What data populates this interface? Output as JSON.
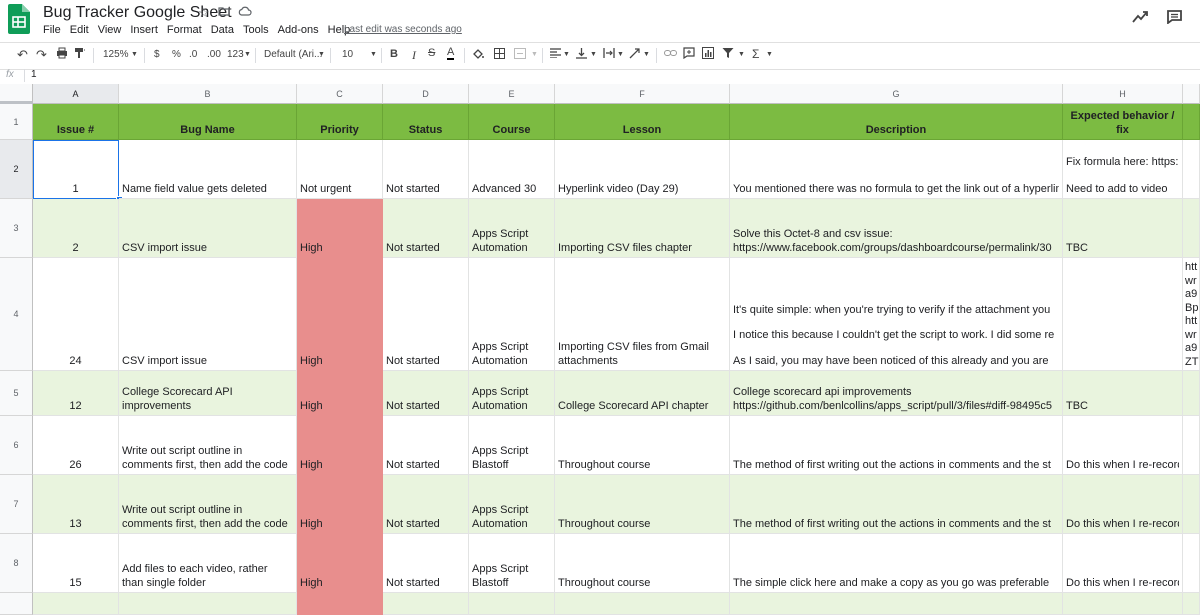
{
  "app": {
    "title": "Bug Tracker Google Sheet",
    "last_edit": "Last edit was seconds ago",
    "menus": [
      "File",
      "Edit",
      "View",
      "Insert",
      "Format",
      "Data",
      "Tools",
      "Add-ons",
      "Help"
    ],
    "brand_color": "#0f9d58"
  },
  "toolbar": {
    "zoom": "125%",
    "currency": "$",
    "percent": "%",
    "dec_decrease": ".0",
    "dec_increase": ".00",
    "more_formats": "123",
    "font": "Default (Ari...",
    "font_size": "10",
    "bold": "B",
    "italic": "I",
    "text_color": "A",
    "functions": "Σ"
  },
  "formula_bar": {
    "fx": "fx",
    "value": "1"
  },
  "columns": [
    "A",
    "B",
    "C",
    "D",
    "E",
    "F",
    "G",
    "H"
  ],
  "rows": [
    "1",
    "2",
    "3",
    "4",
    "5",
    "6",
    "7",
    "8"
  ],
  "header": {
    "issue": "Issue #",
    "bug_name": "Bug Name",
    "priority": "Priority",
    "status": "Status",
    "course": "Course",
    "lesson": "Lesson",
    "description": "Description",
    "expected": "Expected behavior /",
    "expected_2": "fix"
  },
  "data_rows": [
    {
      "issue": "1",
      "bug_name": "Name field value gets deleted",
      "priority": "Not urgent",
      "status": "Not started",
      "course": "Advanced 30",
      "lesson": "Hyperlink video (Day 29)",
      "description": "You mentioned there was no formula to get the link out of a hyperlink",
      "expected_top": "Fix formula here: https:",
      "expected": "Need to add to video"
    },
    {
      "issue": "2",
      "bug_name": "CSV import issue",
      "priority": "High",
      "status": "Not started",
      "course_1": "Apps Script",
      "course_2": "Automation",
      "lesson": "Importing CSV files chapter",
      "desc_1": "Solve this Octet-8 and csv issue:",
      "desc_2": "https://www.facebook.com/groups/dashboardcourse/permalink/30",
      "expected": "TBC"
    },
    {
      "issue": "24",
      "bug_name": "CSV import issue",
      "priority": "High",
      "status": "Not started",
      "course_1": "Apps Script",
      "course_2": "Automation",
      "lesson_1": "Importing CSV files from Gmail",
      "lesson_2": "attachments",
      "desc_1": "It's quite simple: when you're trying to verify if the attachment you",
      "desc_2": "I notice this because I couldn't get the script to work. I did some re",
      "desc_3": "As I said, you may have been noticed of this already and you are",
      "overflow": [
        "htt",
        "wr",
        "a9",
        "Bp",
        "htt",
        "wr",
        "a9",
        "ZT"
      ]
    },
    {
      "issue": "12",
      "bug_1": "College Scorecard API",
      "bug_2": "improvements",
      "priority": "High",
      "status": "Not started",
      "course_1": "Apps Script",
      "course_2": "Automation",
      "lesson": "College Scorecard API chapter",
      "desc_1": "College scorecard api improvements",
      "desc_2": "https://github.com/benlcollins/apps_script/pull/3/files#diff-98495c5",
      "expected": "TBC"
    },
    {
      "issue": "26",
      "bug_1": "Write out script outline in",
      "bug_2": "comments first, then add the code",
      "priority": "High",
      "status": "Not started",
      "course_1": "Apps Script",
      "course_2": "Blastoff",
      "lesson": "Throughout course",
      "description": "The method of first writing out the actions in comments and the st",
      "expected": "Do this when I re-record"
    },
    {
      "issue": "13",
      "bug_1": "Write out script outline in",
      "bug_2": "comments first, then add the code",
      "priority": "High",
      "status": "Not started",
      "course_1": "Apps Script",
      "course_2": "Automation",
      "lesson": "Throughout course",
      "description": "The method of first writing out the actions in comments and the st",
      "expected": "Do this when I re-record"
    },
    {
      "issue": "15",
      "bug_1": "Add files to each video, rather",
      "bug_2": "than single folder",
      "priority": "High",
      "status": "Not started",
      "course_1": "Apps Script",
      "course_2": "Blastoff",
      "lesson": "Throughout course",
      "description": "The simple click here and make a copy as you go was preferable",
      "expected": "Do this when I re-record"
    }
  ],
  "colors": {
    "header_green": "#7cbb42",
    "band_green": "#e9f4de",
    "priority_high": "#e88e8d",
    "selection_blue": "#1a73e8"
  }
}
